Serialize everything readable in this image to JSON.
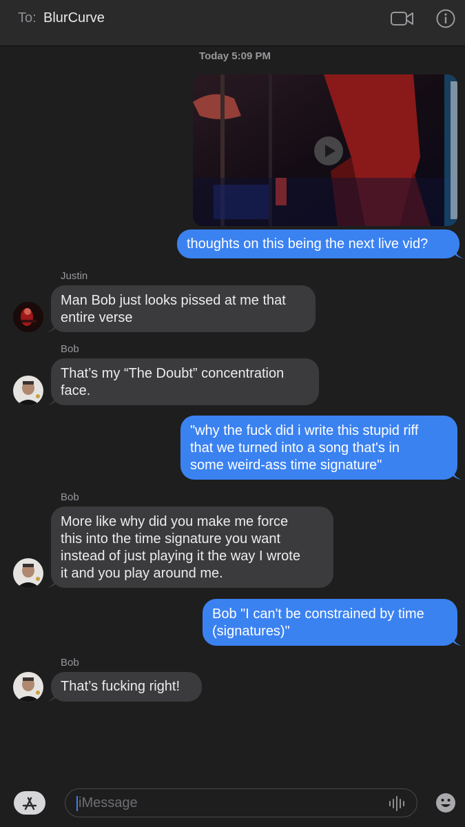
{
  "header": {
    "to_label": "To:",
    "recipient": "BlurCurve",
    "video_icon": "video-camera-icon",
    "info_icon": "info-icon"
  },
  "timestamp": "Today 5:09 PM",
  "messages": [
    {
      "type": "video",
      "direction": "outgoing"
    },
    {
      "direction": "outgoing",
      "lines": [
        "thoughts on this being the next live vid?"
      ]
    },
    {
      "direction": "incoming",
      "sender": "Justin",
      "lines": [
        "Man Bob just looks pissed at me that",
        "entire verse"
      ]
    },
    {
      "direction": "incoming",
      "sender": "Bob",
      "lines": [
        "That’s my “The Doubt” concentration",
        "face."
      ]
    },
    {
      "direction": "outgoing",
      "lines": [
        "\"why the fuck did i write this stupid riff",
        "that we turned into a song that's in",
        "some weird-ass time signature\""
      ]
    },
    {
      "direction": "incoming",
      "sender": "Bob",
      "lines": [
        "More like why did you make me force",
        "this into the time signature you want",
        "instead of just playing it the way I wrote",
        "it and you play around me."
      ]
    },
    {
      "direction": "outgoing",
      "lines": [
        "Bob \"I can't be constrained by time",
        "(signatures)\""
      ]
    },
    {
      "direction": "incoming",
      "sender": "Bob",
      "lines": [
        "That’s fucking right!"
      ]
    }
  ],
  "composer": {
    "placeholder": "iMessage",
    "appstore_icon": "app-store-icon",
    "audio_icon": "audio-waveform-icon",
    "emoji_icon": "emoji-icon"
  },
  "colors": {
    "outgoing_bubble": "#3b82f1",
    "incoming_bubble": "#3b3b3d",
    "background": "#1e1e1e"
  }
}
